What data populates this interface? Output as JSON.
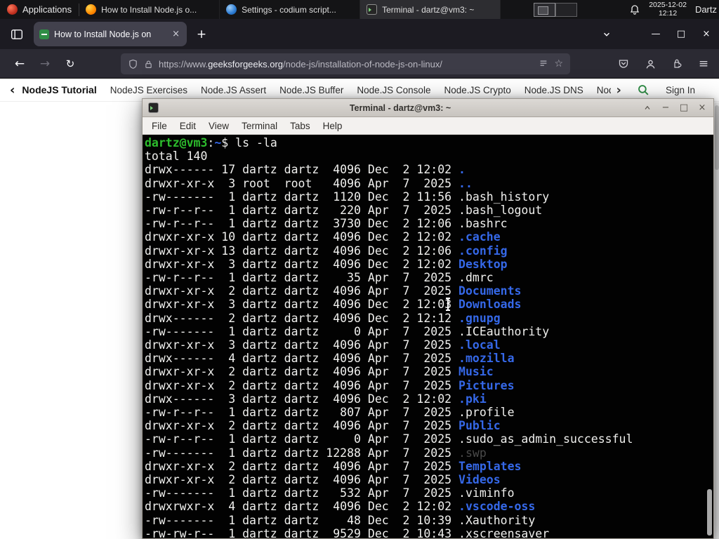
{
  "colors": {
    "gfg_green": "#2f8d46",
    "dir_blue": "#3568e8",
    "prompt_green": "#2dbd2d"
  },
  "panel": {
    "applications_label": "Applications",
    "windows": [
      {
        "label": "How to Install Node.js o...",
        "icon": "firefox-icon"
      },
      {
        "label": "Settings - codium script...",
        "icon": "settings-icon"
      },
      {
        "label": "Terminal - dartz@vm3: ~",
        "icon": "terminal-icon"
      }
    ],
    "clock": {
      "date": "2025-12-02",
      "time": "12:12"
    },
    "user_label": "Dartz"
  },
  "browser": {
    "tab_title": "How to Install Node.js on",
    "tab_close": "×",
    "new_tab": "+",
    "back": "←",
    "forward": "→",
    "reload": "↻",
    "url_prefix": "https://www.",
    "url_domain": "geeksforgeeks.org",
    "url_path": "/node-js/installation-of-node-js-on-linux/",
    "star": "☆",
    "menu_glyph": "≡",
    "window_controls": {
      "minimize": "—",
      "maximize": "□",
      "close": "×"
    }
  },
  "site_nav": {
    "back_chevron": "‹",
    "items": [
      "NodeJS Tutorial",
      "NodeJS Exercises",
      "Node.JS Assert",
      "Node.JS Buffer",
      "Node.JS Console",
      "Node.JS Crypto",
      "Node.JS DNS",
      "Node"
    ],
    "forward_chevron": "›",
    "sign_in_label": "Sign In"
  },
  "terminal": {
    "title": "Terminal - dartz@vm3: ~",
    "menu": [
      "File",
      "Edit",
      "View",
      "Terminal",
      "Tabs",
      "Help"
    ],
    "window_controls": {
      "minimize": "−",
      "maximize": "□",
      "close": "×"
    },
    "prompt": {
      "user_host": "dartz@vm3",
      "colon": ":",
      "cwd": "~",
      "dollar": "$ ",
      "command": "ls -la"
    },
    "total_line": "total 140",
    "listing": [
      {
        "meta": "drwx------ 17 dartz dartz  4096 Dec  2 12:02 ",
        "name": ".",
        "type": "d"
      },
      {
        "meta": "drwxr-xr-x  3 root  root   4096 Apr  7  2025 ",
        "name": "..",
        "type": "d"
      },
      {
        "meta": "-rw-------  1 dartz dartz  1120 Dec  2 11:56 ",
        "name": ".bash_history",
        "type": "f"
      },
      {
        "meta": "-rw-r--r--  1 dartz dartz   220 Apr  7  2025 ",
        "name": ".bash_logout",
        "type": "f"
      },
      {
        "meta": "-rw-r--r--  1 dartz dartz  3730 Dec  2 12:06 ",
        "name": ".bashrc",
        "type": "f"
      },
      {
        "meta": "drwxr-xr-x 10 dartz dartz  4096 Dec  2 12:02 ",
        "name": ".cache",
        "type": "d"
      },
      {
        "meta": "drwxr-xr-x 13 dartz dartz  4096 Dec  2 12:06 ",
        "name": ".config",
        "type": "d"
      },
      {
        "meta": "drwxr-xr-x  3 dartz dartz  4096 Dec  2 12:02 ",
        "name": "Desktop",
        "type": "d"
      },
      {
        "meta": "-rw-r--r--  1 dartz dartz    35 Apr  7  2025 ",
        "name": ".dmrc",
        "type": "f"
      },
      {
        "meta": "drwxr-xr-x  2 dartz dartz  4096 Apr  7  2025 ",
        "name": "Documents",
        "type": "d"
      },
      {
        "meta": "drwxr-xr-x  3 dartz dartz  4096 Dec  2 12:03 ",
        "name": "Downloads",
        "type": "d"
      },
      {
        "meta": "drwx------  2 dartz dartz  4096 Dec  2 12:12 ",
        "name": ".gnupg",
        "type": "d"
      },
      {
        "meta": "-rw-------  1 dartz dartz     0 Apr  7  2025 ",
        "name": ".ICEauthority",
        "type": "f"
      },
      {
        "meta": "drwxr-xr-x  3 dartz dartz  4096 Apr  7  2025 ",
        "name": ".local",
        "type": "d"
      },
      {
        "meta": "drwx------  4 dartz dartz  4096 Apr  7  2025 ",
        "name": ".mozilla",
        "type": "d"
      },
      {
        "meta": "drwxr-xr-x  2 dartz dartz  4096 Apr  7  2025 ",
        "name": "Music",
        "type": "d"
      },
      {
        "meta": "drwxr-xr-x  2 dartz dartz  4096 Apr  7  2025 ",
        "name": "Pictures",
        "type": "d"
      },
      {
        "meta": "drwx------  3 dartz dartz  4096 Dec  2 12:02 ",
        "name": ".pki",
        "type": "d"
      },
      {
        "meta": "-rw-r--r--  1 dartz dartz   807 Apr  7  2025 ",
        "name": ".profile",
        "type": "f"
      },
      {
        "meta": "drwxr-xr-x  2 dartz dartz  4096 Apr  7  2025 ",
        "name": "Public",
        "type": "d"
      },
      {
        "meta": "-rw-r--r--  1 dartz dartz     0 Apr  7  2025 ",
        "name": ".sudo_as_admin_successful",
        "type": "f"
      },
      {
        "meta": "-rw-------  1 dartz dartz 12288 Apr  7  2025 ",
        "name": ".swp",
        "type": "x"
      },
      {
        "meta": "drwxr-xr-x  2 dartz dartz  4096 Apr  7  2025 ",
        "name": "Templates",
        "type": "d"
      },
      {
        "meta": "drwxr-xr-x  2 dartz dartz  4096 Apr  7  2025 ",
        "name": "Videos",
        "type": "d"
      },
      {
        "meta": "-rw-------  1 dartz dartz   532 Apr  7  2025 ",
        "name": ".viminfo",
        "type": "f"
      },
      {
        "meta": "drwxrwxr-x  4 dartz dartz  4096 Dec  2 12:02 ",
        "name": ".vscode-oss",
        "type": "d"
      },
      {
        "meta": "-rw-------  1 dartz dartz    48 Dec  2 10:39 ",
        "name": ".Xauthority",
        "type": "f"
      },
      {
        "meta": "-rw-rw-r--  1 dartz dartz  9529 Dec  2 10:43 ",
        "name": ".xscreensaver",
        "type": "f"
      }
    ]
  }
}
